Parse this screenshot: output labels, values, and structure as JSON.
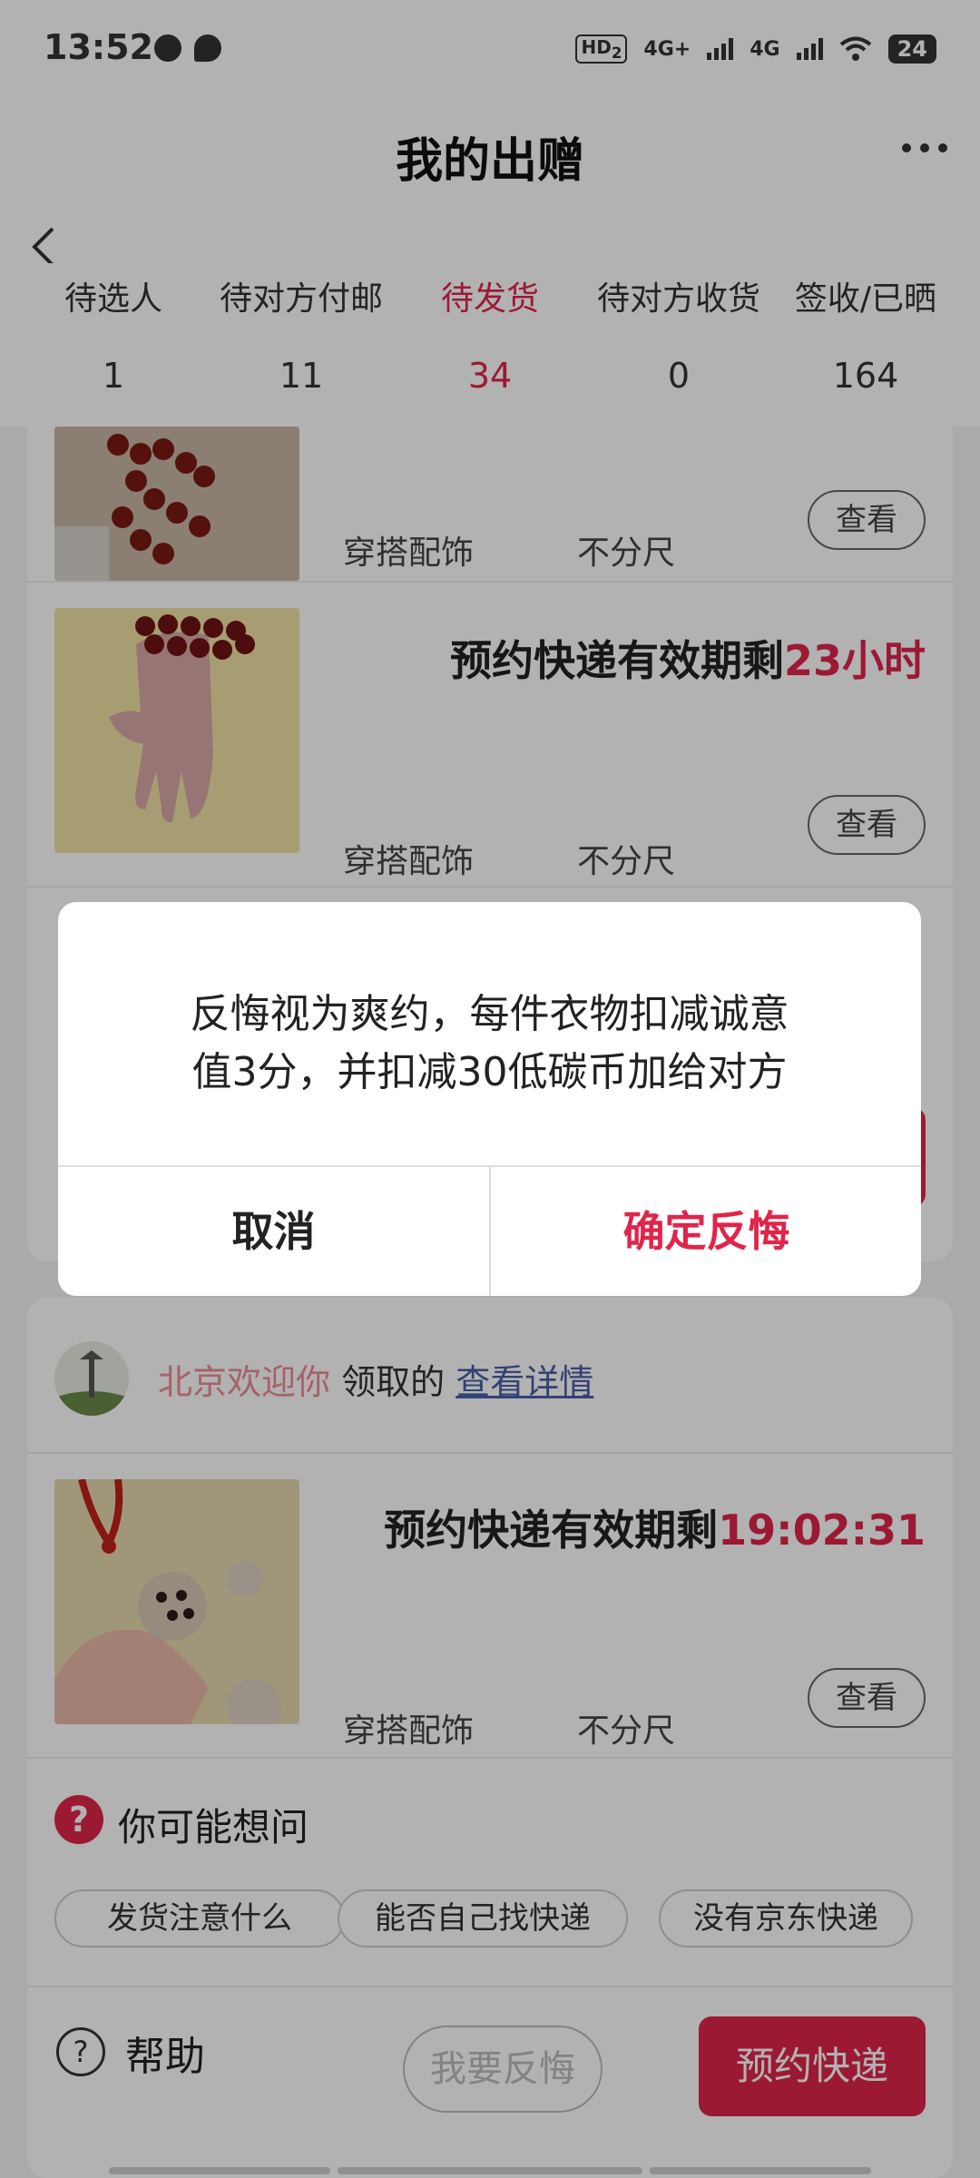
{
  "status_bar": {
    "time": "13:52",
    "left_icons": [
      "alarm-icon",
      "message-bubble-icon"
    ],
    "hd_badge": "HD",
    "hd_sub": "2",
    "net1": "4G+",
    "net2": "4G",
    "battery": "24"
  },
  "header": {
    "title": "我的出赠",
    "back_icon": "chevron-left-icon",
    "more_icon": "more-dots-icon"
  },
  "tabs": [
    {
      "label": "待选人",
      "count": "1"
    },
    {
      "label": "待对方付邮",
      "count": "11"
    },
    {
      "label": "待发货",
      "count": "34",
      "active": true
    },
    {
      "label": "待对方收货",
      "count": "0"
    },
    {
      "label": "签收/已晒",
      "count": "164"
    }
  ],
  "items": [
    {
      "category": "穿搭配饰",
      "size": "不分尺",
      "view_label": "查看"
    },
    {
      "deadline_prefix": "预约快递有效期剩",
      "deadline_value": "23小时",
      "category": "穿搭配饰",
      "size": "不分尺",
      "view_label": "查看"
    }
  ],
  "order2": {
    "owner_name": "北京欢迎你",
    "owner_action": " 领取的 ",
    "detail_link": "查看详情",
    "item": {
      "deadline_prefix": "预约快递有效期剩",
      "deadline_value": "19:02:31",
      "category": "穿搭配饰",
      "size": "不分尺",
      "view_label": "查看"
    },
    "faq": {
      "title": "你可能想问",
      "chips": [
        "发货注意什么",
        "能否自己找快递",
        "没有京东快递"
      ]
    },
    "footer": {
      "help_label": "帮助",
      "regret_label": "我要反悔",
      "book_label": "预约快递"
    }
  },
  "dialog": {
    "line1": "反悔视为爽约，每件衣物扣减诚意",
    "line2": "值3分，并扣减30低碳币加给对方",
    "cancel_label": "取消",
    "confirm_label": "确定反悔"
  },
  "colors": {
    "accent": "#e0254a",
    "link": "#4a5fa8",
    "owner_name": "#f08c96"
  }
}
